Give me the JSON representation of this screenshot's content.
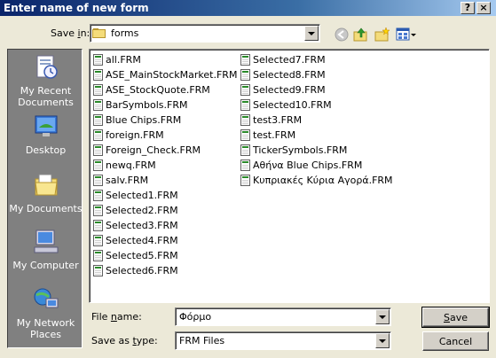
{
  "window": {
    "title": "Enter name of new form",
    "help_glyph": "?",
    "close_glyph": "×"
  },
  "savein": {
    "label_prefix": "Save ",
    "label_accel": "i",
    "label_suffix": "n:",
    "folder": "forms"
  },
  "places": [
    {
      "label": "My Recent Documents",
      "icon": "recent-documents-icon"
    },
    {
      "label": "Desktop",
      "icon": "desktop-icon"
    },
    {
      "label": "My Documents",
      "icon": "my-documents-icon"
    },
    {
      "label": "My Computer",
      "icon": "my-computer-icon"
    },
    {
      "label": "My Network Places",
      "icon": "network-places-icon"
    }
  ],
  "files": {
    "column1": [
      "all.FRM",
      "ASE_MainStockMarket.FRM",
      "ASE_StockQuote.FRM",
      "BarSymbols.FRM",
      "Blue Chips.FRM",
      "foreign.FRM",
      "Foreign_Check.FRM",
      "newq.FRM",
      "salv.FRM",
      "Selected1.FRM",
      "Selected2.FRM",
      "Selected3.FRM",
      "Selected4.FRM",
      "Selected5.FRM",
      "Selected6.FRM"
    ],
    "column2": [
      "Selected7.FRM",
      "Selected8.FRM",
      "Selected9.FRM",
      "Selected10.FRM",
      "test3.FRM",
      "test.FRM",
      "TickerSymbols.FRM",
      "Αθήνα Blue Chips.FRM",
      "Κυπριακές Κύρια Αγορά.FRM"
    ]
  },
  "filename": {
    "label_prefix": "File ",
    "label_accel": "n",
    "label_suffix": "ame:",
    "value": "Φόρμο"
  },
  "savetype": {
    "label_prefix": "Save as ",
    "label_accel": "t",
    "label_suffix": "ype:",
    "value": "FRM Files"
  },
  "buttons": {
    "save_accel": "S",
    "save_rest": "ave",
    "cancel": "Cancel"
  },
  "colors": {
    "title_bar": "#0a246a",
    "dialog_bg": "#ece9d8",
    "places_bg": "#808080"
  }
}
